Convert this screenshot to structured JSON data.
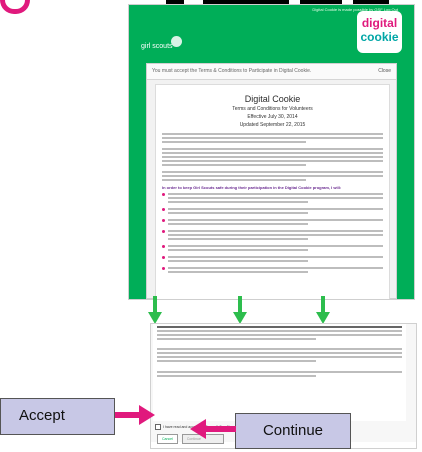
{
  "header": {
    "utility_text": "Digital Cookie is made possible by GSF    Log Out",
    "org_logo": "girl scouts",
    "product_logo": {
      "line1": "digital",
      "line2": "cookie"
    }
  },
  "terms_modal": {
    "banner": "You must accept the Terms & Conditions to Participate in Digital Cookie.",
    "close_label": "Close",
    "doc_title": "Digital Cookie",
    "doc_subtitle": "Terms and Conditions for Volunteers",
    "effective": "Effective July 30, 2014",
    "updated": "Updated September 22, 2015",
    "section_heading": "In order to keep Girl Scouts safe during their participation in the Digital Cookie program, I will:"
  },
  "bottom_screen": {
    "accept_label": "I have read and accept the Terms & Conditions",
    "cancel_label": "Cancel",
    "continue_label": "Continue"
  },
  "callouts": {
    "accept": "Accept",
    "continue": "Continue"
  },
  "colors": {
    "girl_scouts_green": "#00ae58",
    "callout_fill": "#c8c8e6",
    "arrow_green": "#2dbd4d",
    "arrow_magenta": "#e0197d"
  }
}
